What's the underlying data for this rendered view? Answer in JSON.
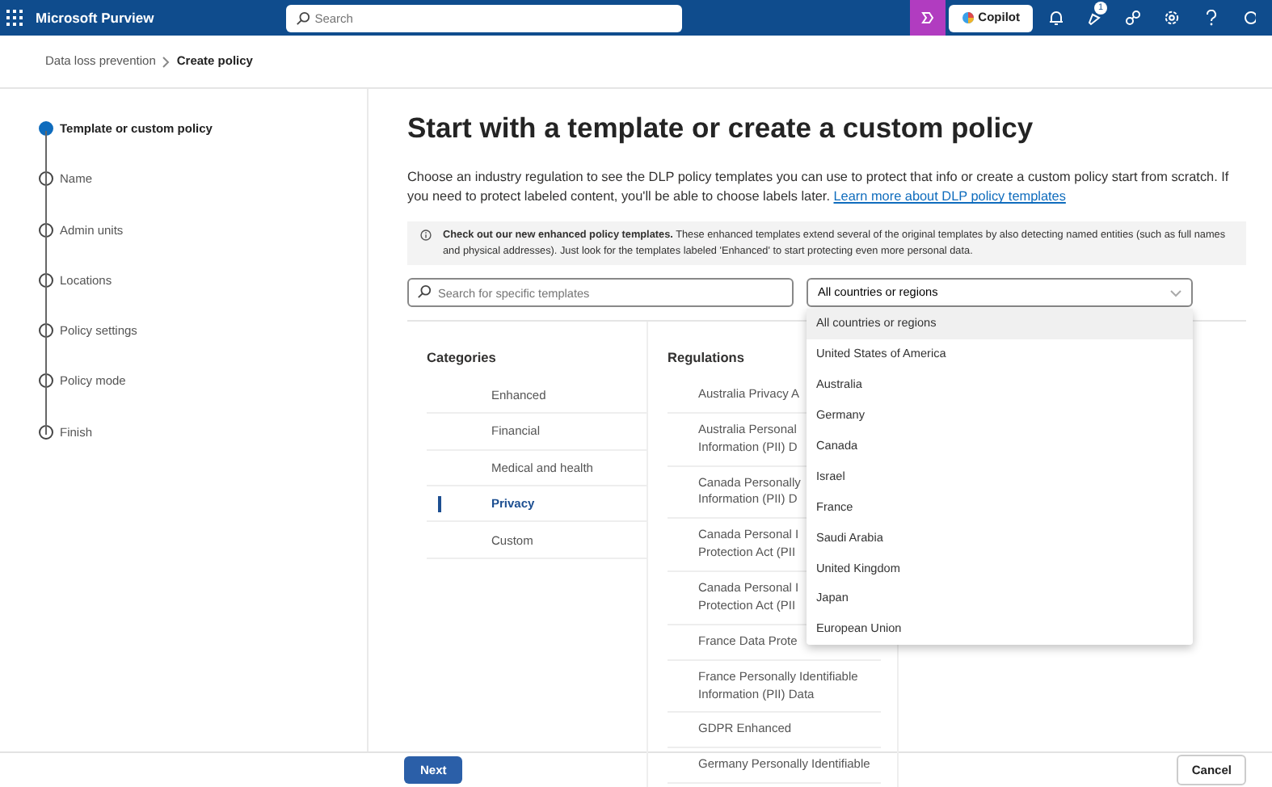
{
  "app_bar": {
    "title": "Microsoft Purview",
    "search": {
      "placeholder": "Search"
    },
    "copilot_button": "Copilot",
    "notification_badge": "1"
  },
  "breadcrumb": [
    {
      "label": "Data loss prevention",
      "current": false
    },
    {
      "label": "Create policy",
      "current": true
    }
  ],
  "steps": [
    {
      "label": "Template or custom policy",
      "selected": true
    },
    {
      "label": "Name",
      "selected": false
    },
    {
      "label": "Admin units",
      "selected": false
    },
    {
      "label": "Locations",
      "selected": false
    },
    {
      "label": "Policy settings",
      "selected": false
    },
    {
      "label": "Policy mode",
      "selected": false
    },
    {
      "label": "Finish",
      "selected": false
    }
  ],
  "page": {
    "title": "Start with a template or create a custom policy",
    "description": "Choose an industry regulation to see the DLP policy templates you can use to protect that info or create a custom policy start from scratch. If you need to protect labeled content, you'll be able to choose labels later.",
    "link": "Learn more about DLP policy templates",
    "notice": "**Check out our new enhanced policy templates.** These enhanced templates extend several of the original templates by also detecting named entities (such as full names and physical addresses). Just look for the templates labeled 'Enhanced' to start protecting even more personal data.",
    "search": {
      "placeholder": "Search for specific templates"
    },
    "region_select": {
      "value": "All countries or regions",
      "expanded": true,
      "options": [
        {
          "label": "All countries or regions",
          "selected": true
        },
        {
          "label": "United States of America",
          "selected": false
        },
        {
          "label": "Australia",
          "selected": false
        },
        {
          "label": "Germany",
          "selected": false
        },
        {
          "label": "Canada",
          "selected": false
        },
        {
          "label": "Israel",
          "selected": false
        },
        {
          "label": "France",
          "selected": false
        },
        {
          "label": "Saudi Arabia",
          "selected": false
        },
        {
          "label": "United Kingdom",
          "selected": false
        },
        {
          "label": "Japan",
          "selected": false
        },
        {
          "label": "European Union",
          "selected": false
        }
      ]
    }
  },
  "categories": {
    "heading": "Categories",
    "items": [
      {
        "label": "Enhanced",
        "selected": false
      },
      {
        "label": "Financial",
        "selected": false
      },
      {
        "label": "Medical and health",
        "selected": false
      },
      {
        "label": "Privacy",
        "selected": true
      },
      {
        "label": "Custom",
        "selected": false
      }
    ]
  },
  "regulations": {
    "heading": "Regulations",
    "items": [
      "Australia Privacy A",
      "Australia Personal\nInformation (PII) D",
      "Canada Personally\nInformation (PII) D",
      "Canada Personal I\nProtection Act (PII",
      "Canada Personal I\nProtection Act (PII",
      "France Data Prote",
      "France Personally Identifiable\nInformation (PII) Data",
      "GDPR Enhanced",
      "Germany Personally Identifiable"
    ]
  },
  "footer": {
    "buttons": [
      {
        "label": "Next",
        "kind": "primary"
      },
      {
        "label": "Cancel",
        "kind": "secondary"
      }
    ]
  }
}
